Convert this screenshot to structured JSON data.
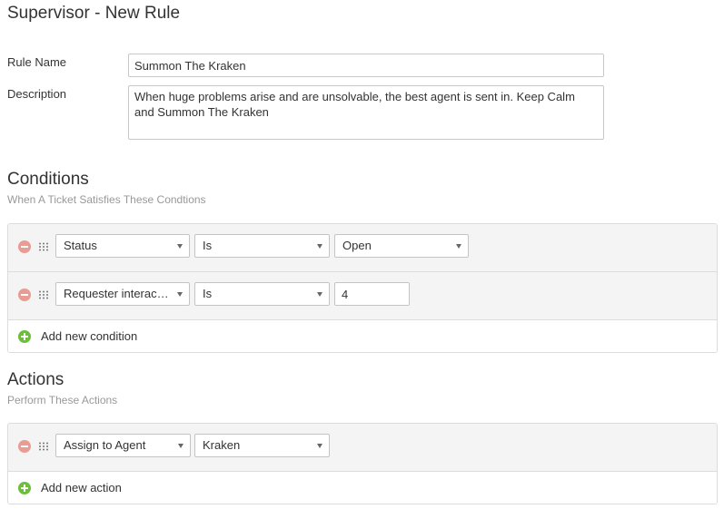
{
  "page": {
    "title": "Supervisor - New Rule"
  },
  "form": {
    "rule_name_label": "Rule Name",
    "rule_name_value": "Summon The Kraken",
    "description_label": "Description",
    "description_value": "When huge problems arise and are unsolvable, the best agent is sent in. Keep Calm and Summon The Kraken"
  },
  "conditions": {
    "title": "Conditions",
    "subtitle": "When A Ticket Satisfies These Condtions",
    "rows": [
      {
        "field": "Status",
        "operator": "Is",
        "value": "Open"
      },
      {
        "field": "Requester interacti…",
        "operator": "Is",
        "value": "4"
      }
    ],
    "add_label": "Add new condition"
  },
  "actions": {
    "title": "Actions",
    "subtitle": "Perform These Actions",
    "rows": [
      {
        "action": "Assign to Agent",
        "value": "Kraken"
      }
    ],
    "add_label": "Add new action"
  },
  "colors": {
    "remove_icon": "#e89c93",
    "add_icon": "#6cbf3a",
    "row_background": "#f4f4f4"
  }
}
